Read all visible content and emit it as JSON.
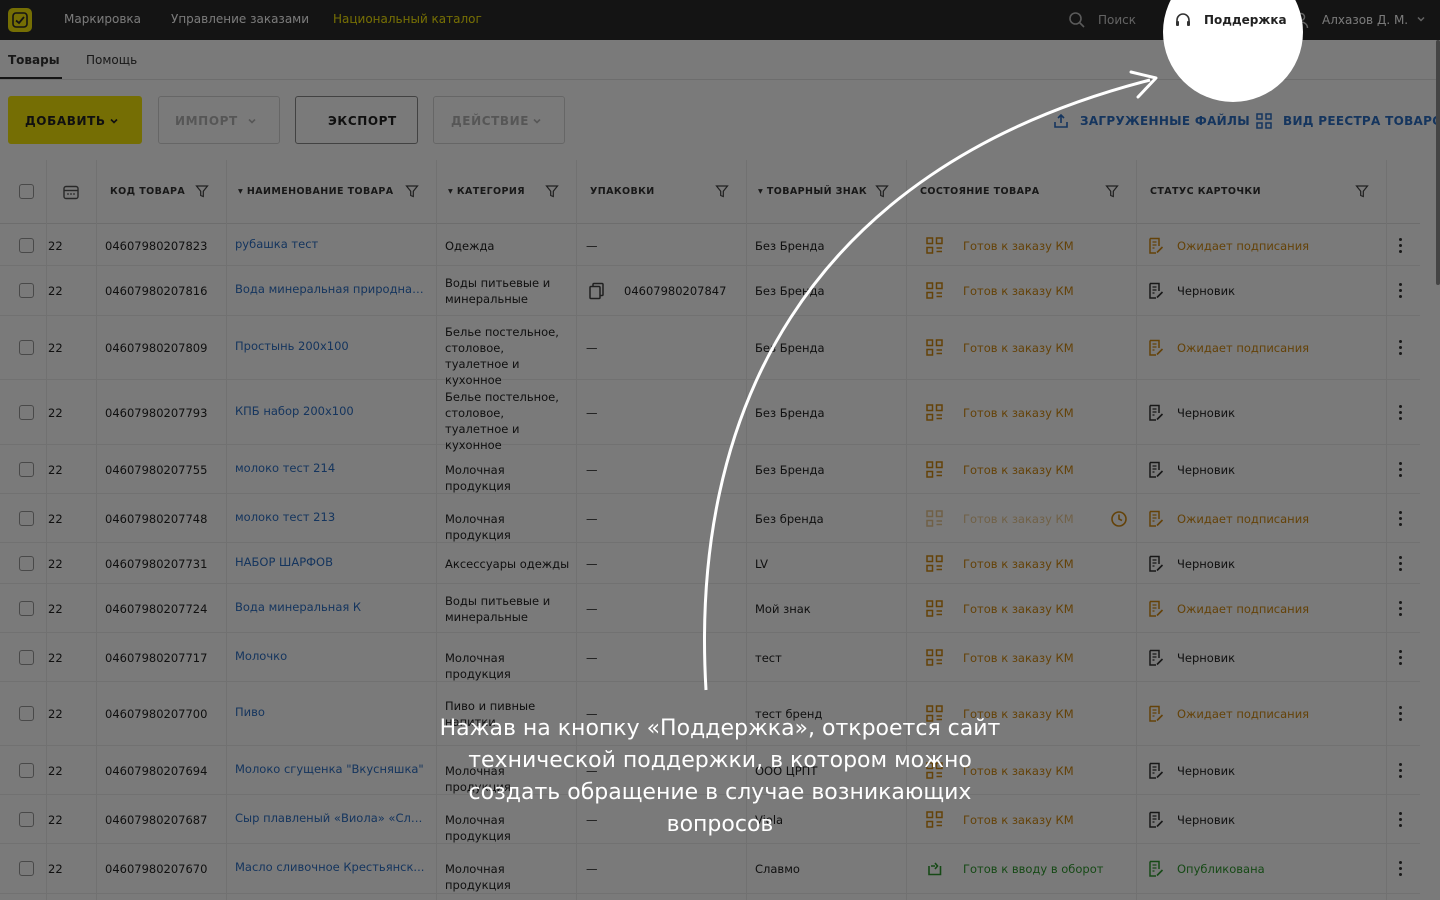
{
  "topbar": {
    "nav": [
      "Маркировка",
      "Управление заказами",
      "Национальный каталог"
    ],
    "search_placeholder": "Поиск",
    "support_label": "Поддержка",
    "user_name": "Алхазов Д. М."
  },
  "subtabs": [
    "Товары",
    "Помощь"
  ],
  "toolbar": {
    "add": "ДОБАВИТЬ",
    "import": "ИМПОРТ",
    "export": "ЭКСПОРТ",
    "action": "ДЕЙСТВИЕ",
    "uploaded_files": "ЗАГРУЖЕННЫЕ ФАЙЛЫ",
    "registry_view": "ВИД РЕЕСТРА ТОВАРОВ"
  },
  "table": {
    "headers": {
      "code": "КОД ТОВАРА",
      "name": "НАИМЕНОВАНИЕ ТОВАРА",
      "category": "КАТЕГОРИЯ",
      "packages": "УПАКОВКИ",
      "brand": "ТОВАРНЫЙ ЗНАК",
      "state": "СОСТОЯНИЕ ТОВАРА",
      "card_status": "СТАТУС КАРТОЧКИ"
    },
    "rows": [
      {
        "date": "22",
        "code": "04607980207823",
        "name": "рубашка тест",
        "category": "Одежда",
        "packages": "—",
        "brand": "Без Бренда",
        "state": "Готов к заказу КМ",
        "card": "Ожидает подписания"
      },
      {
        "date": "22",
        "code": "04607980207816",
        "name": "Вода минеральная природная...",
        "category": "Воды питьевые и минеральные",
        "packages": "04607980207847",
        "brand": "Без Бренда",
        "state": "Готов к заказу КМ",
        "card": "Черновик"
      },
      {
        "date": "22",
        "code": "04607980207809",
        "name": "Простынь 200х100",
        "category": "Белье постельное, столовое, туалетное и кухонное",
        "packages": "—",
        "brand": "Без Бренда",
        "state": "Готов к заказу КМ",
        "card": "Ожидает подписания"
      },
      {
        "date": "22",
        "code": "04607980207793",
        "name": "КПБ набор 200х100",
        "category": "Белье постельное, столовое, туалетное и кухонное",
        "packages": "—",
        "brand": "Без Бренда",
        "state": "Готов к заказу КМ",
        "card": "Черновик"
      },
      {
        "date": "22",
        "code": "04607980207755",
        "name": "молоко тест 214",
        "category": "Молочная продукция",
        "packages": "—",
        "brand": "Без Бренда",
        "state": "Готов к заказу КМ",
        "card": "Черновик"
      },
      {
        "date": "22",
        "code": "04607980207748",
        "name": "молоко тест 213",
        "category": "Молочная продукция",
        "packages": "—",
        "brand": "Без бренда",
        "state": "Готов к заказу КМ",
        "card": "Ожидает подписания"
      },
      {
        "date": "22",
        "code": "04607980207731",
        "name": "НАБОР ШАРФОВ",
        "category": "Аксессуары одежды",
        "packages": "—",
        "brand": "LV",
        "state": "Готов к заказу КМ",
        "card": "Черновик"
      },
      {
        "date": "22",
        "code": "04607980207724",
        "name": "Вода минеральная К",
        "category": "Воды питьевые и минеральные",
        "packages": "—",
        "brand": "Мой знак",
        "state": "Готов к заказу КМ",
        "card": "Ожидает подписания"
      },
      {
        "date": "22",
        "code": "04607980207717",
        "name": "Молочко",
        "category": "Молочная продукция",
        "packages": "—",
        "brand": "тест",
        "state": "Готов к заказу КМ",
        "card": "Черновик"
      },
      {
        "date": "22",
        "code": "04607980207700",
        "name": "Пиво",
        "category": "Пиво и пивные напитки",
        "packages": "—",
        "brand": "тест бренд",
        "state": "Готов к заказу КМ",
        "card": "Ожидает подписания"
      },
      {
        "date": "22",
        "code": "04607980207694",
        "name": "Молоко сгущенка \"Вкусняшка\"",
        "category": "Молочная продукция",
        "packages": "—",
        "brand": "ООО ЦРПТ",
        "state": "Готов к заказу КМ",
        "card": "Черновик"
      },
      {
        "date": "22",
        "code": "04607980207687",
        "name": "Сыр плавленый «Виола» «Сли...",
        "category": "Молочная продукция",
        "packages": "—",
        "brand": "Viola",
        "state": "Готов к заказу КМ",
        "card": "Черновик"
      },
      {
        "date": "22",
        "code": "04607980207670",
        "name": "Масло сливочное Крестьянск...",
        "category": "Молочная продукция",
        "packages": "—",
        "brand": "Славмо",
        "state": "Готов к вводу в оборот",
        "card": "Опубликована"
      }
    ]
  },
  "caption": "Нажав на кнопку «Поддержка», откроется сайт технической поддержки, в котором можно создать обращение в случае возникающих вопросов",
  "colors": {
    "accent": "#f4e50a",
    "link": "#2d6fc4",
    "warning": "#d18a12",
    "success": "#2f9a2f",
    "topbar": "#2b2b2b"
  }
}
